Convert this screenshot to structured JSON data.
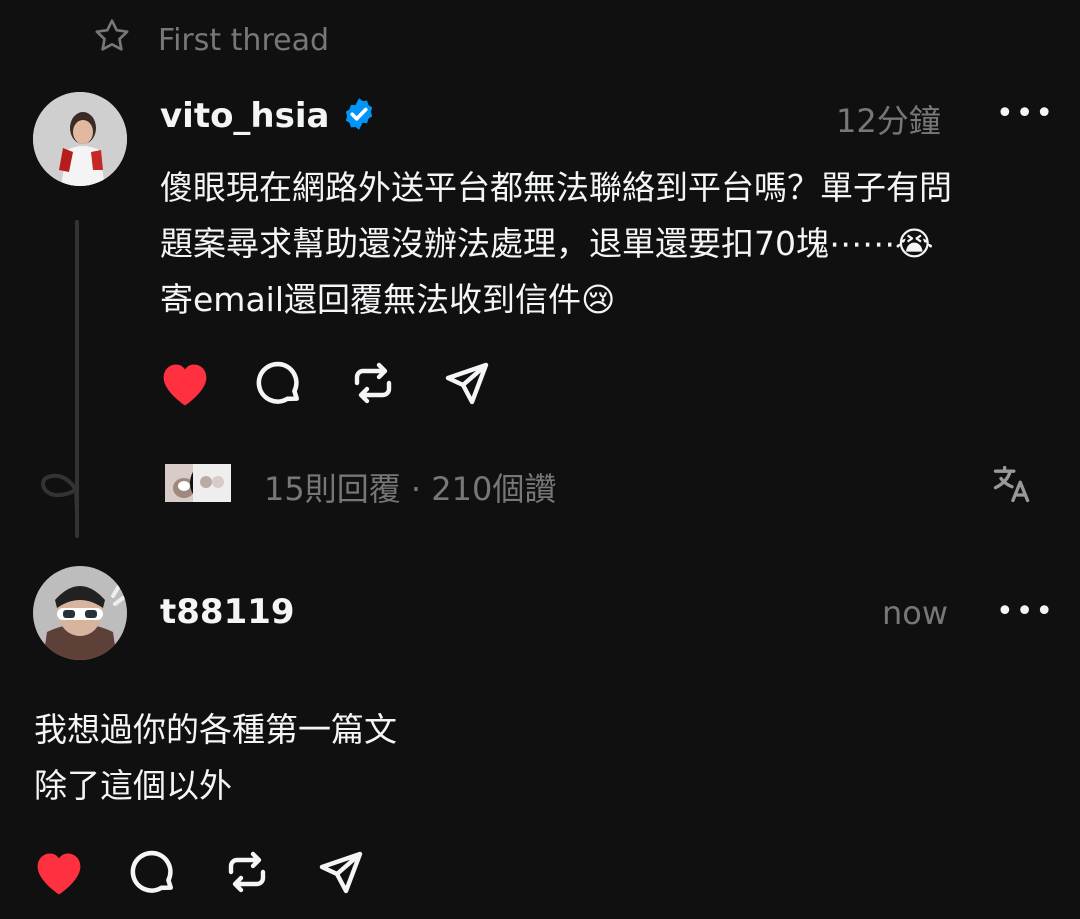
{
  "header": {
    "label": "First thread",
    "star_icon": "star-icon"
  },
  "post": {
    "username": "vito_hsia",
    "verified": true,
    "time": "12分鐘",
    "more": "•••",
    "text": "傻眼現在網路外送平台都無法聯絡到平台嗎？單子有問\n題案尋求幫助還沒辦法處理，退單還要扣70塊⋯⋯😭\n寄email還回覆無法收到信件😢",
    "liked": true,
    "stats": "15則回覆 · 210個讚",
    "colors": {
      "like": "#ff3040",
      "verified": "#0095f6"
    }
  },
  "reply": {
    "username": "t88119",
    "time": "now",
    "more": "•••",
    "text": "我想過你的各種第一篇文\n除了這個以外",
    "liked": true
  }
}
